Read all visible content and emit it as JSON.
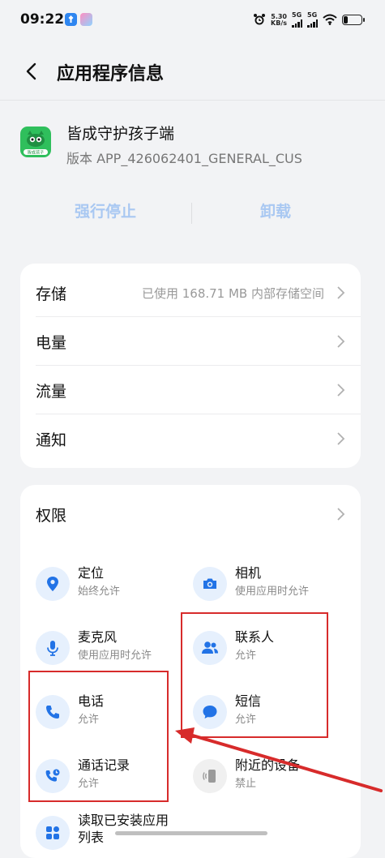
{
  "status_bar": {
    "time": "09:22",
    "net_speed_value": "5.30",
    "net_speed_unit": "KB/s",
    "sim1_label": "5G",
    "sim2_label": "5G",
    "icons": [
      "pin-badge-icon",
      "app-badge-icon",
      "alarm-icon",
      "signal-icon",
      "wifi-icon",
      "battery-icon"
    ]
  },
  "header": {
    "title": "应用程序信息",
    "back_icon": "chevron-left-icon"
  },
  "app": {
    "name": "皆成守护孩子端",
    "version": "版本 APP_426062401_GENERAL_CUS",
    "icon_text": "皆成孩子",
    "icon_color": "#2fbf5c"
  },
  "actions": {
    "force_stop": "强行停止",
    "uninstall": "卸载",
    "disabled_color": "#a9c8f2"
  },
  "settings": {
    "storage_label": "存储",
    "storage_value": "已使用 168.71 MB 内部存储空间",
    "battery_label": "电量",
    "data_label": "流量",
    "notifications_label": "通知"
  },
  "permissions": {
    "title": "权限",
    "items": [
      {
        "name": "定位",
        "status": "始终允许",
        "icon": "location-pin-icon"
      },
      {
        "name": "相机",
        "status": "使用应用时允许",
        "icon": "camera-icon"
      },
      {
        "name": "麦克风",
        "status": "使用应用时允许",
        "icon": "microphone-icon"
      },
      {
        "name": "联系人",
        "status": "允许",
        "icon": "contacts-icon"
      },
      {
        "name": "电话",
        "status": "允许",
        "icon": "phone-icon"
      },
      {
        "name": "短信",
        "status": "允许",
        "icon": "sms-icon"
      },
      {
        "name": "通话记录",
        "status": "允许",
        "icon": "call-log-icon"
      },
      {
        "name": "附近的设备",
        "status": "禁止",
        "icon": "nearby-devices-icon"
      },
      {
        "name": "读取已安装应用列表",
        "name_line1": "读取已安装应用",
        "name_line2": "列表",
        "icon": "app-list-icon"
      }
    ]
  },
  "annotation": {
    "color": "#d72b2b"
  }
}
